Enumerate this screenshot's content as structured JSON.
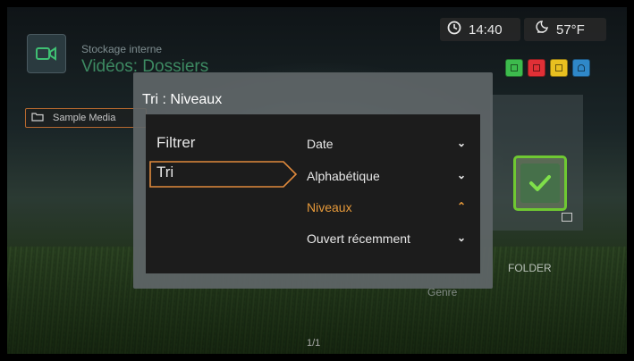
{
  "header": {
    "storage": "Stockage interne",
    "title": "Vidéos: Dossiers",
    "tab_label": "Sample Media"
  },
  "status": {
    "time": "14:40",
    "temperature": "57°F"
  },
  "color_keys": [
    "#3dbb4d",
    "#e03036",
    "#e8c020",
    "#2f88c8"
  ],
  "thumbnail": {
    "folder_label": "FOLDER",
    "genre_label": "Genre",
    "accent": "#6fc832"
  },
  "pagination": "1/1",
  "dialog": {
    "title": "Tri : Niveaux",
    "left_items": [
      "Filtrer",
      "Tri"
    ],
    "selected_left": "Tri",
    "options": [
      {
        "label": "Date",
        "indicator": "chevron-down"
      },
      {
        "label": "Alphabétique",
        "indicator": "chevron-down"
      },
      {
        "label": "Niveaux",
        "indicator": "chevron-up",
        "active": true
      },
      {
        "label": "Ouvert récemment",
        "indicator": "chevron-down"
      }
    ],
    "active_color": "#e79a3a",
    "highlight_color": "#e08a3c"
  }
}
